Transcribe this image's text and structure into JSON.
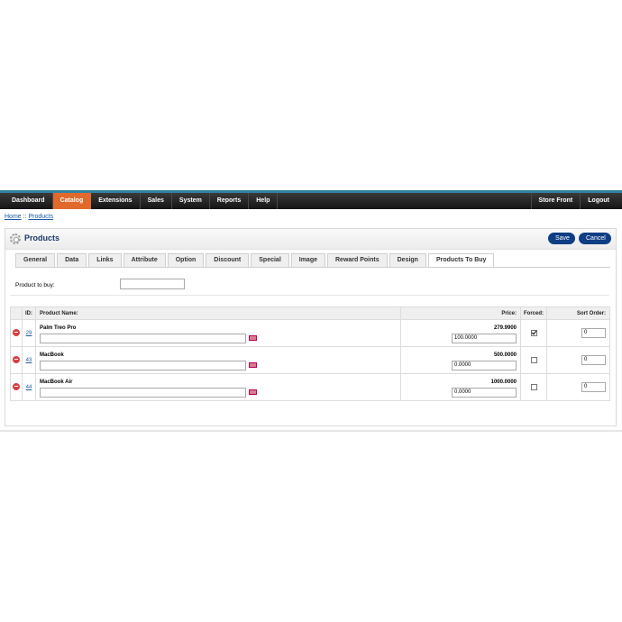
{
  "nav": {
    "left": [
      "Dashboard",
      "Catalog",
      "Extensions",
      "Sales",
      "System",
      "Reports",
      "Help"
    ],
    "active": "Catalog",
    "right": [
      "Store Front",
      "Logout"
    ]
  },
  "breadcrumb": {
    "home": "Home",
    "separator": " :: ",
    "current": "Products"
  },
  "page": {
    "title": "Products",
    "save_label": "Save",
    "cancel_label": "Cancel"
  },
  "tabs": {
    "items": [
      "General",
      "Data",
      "Links",
      "Attribute",
      "Option",
      "Discount",
      "Special",
      "Image",
      "Reward Points",
      "Design",
      "Products To Buy"
    ],
    "active": "Products To Buy"
  },
  "form": {
    "product_to_buy_label": "Product to buy:",
    "product_to_buy_value": ""
  },
  "table": {
    "headers": {
      "id": "ID:",
      "name": "Product Name:",
      "price": "Price:",
      "forced": "Forced:",
      "sort": "Sort Order:"
    },
    "rows": [
      {
        "id": "29",
        "name": "Palm Treo Pro",
        "price": "279.9900",
        "price_input": "100.0000",
        "forced": true,
        "sort": "0"
      },
      {
        "id": "43",
        "name": "MacBook",
        "price": "500.0000",
        "price_input": "0.0000",
        "forced": false,
        "sort": "0"
      },
      {
        "id": "44",
        "name": "MacBook Air",
        "price": "1000.0000",
        "price_input": "0.0000",
        "forced": false,
        "sort": "0"
      }
    ]
  },
  "colors": {
    "nav_active": "#e0692b",
    "button": "#0e3e84",
    "link": "#1c5aa3",
    "accent_bar": "#2f84a6"
  },
  "icons": {
    "page": "gear-icon",
    "remove": "remove-icon",
    "picker": "picker-icon"
  }
}
